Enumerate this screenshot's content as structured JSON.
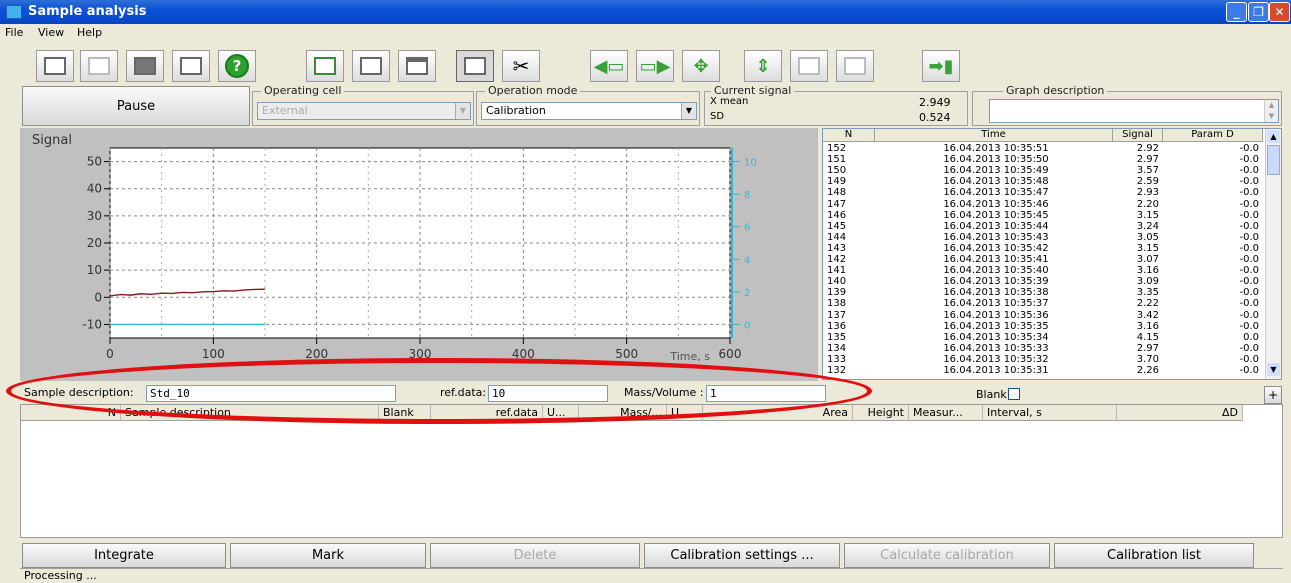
{
  "window": {
    "title": "Sample analysis",
    "minimize": "_",
    "maximize": "❐",
    "close": "✕"
  },
  "menu": [
    "File",
    "View",
    "Help"
  ],
  "toolbar_icons": [
    "new-file-icon",
    "open-folder-icon",
    "save-icon",
    "print-icon",
    "help-icon",
    "graph-icon",
    "table-icon",
    "window-icon",
    "layout-icon",
    "settings-icon",
    "shift-left-icon",
    "shift-right-icon",
    "move-icon",
    "fit-icon",
    "zoom-in-icon",
    "zoom-out-icon",
    "exit-icon"
  ],
  "controls": {
    "pause": "Pause",
    "operating_cell_label": "Operating cell",
    "operating_cell_value": "External",
    "operation_mode_label": "Operation mode",
    "operation_mode_value": "Calibration",
    "current_signal_label": "Current signal",
    "xmean_label": "X mean",
    "xmean_value": "2.949",
    "sd_label": "SD",
    "sd_value": "0.524",
    "graph_description_label": "Graph description",
    "graph_description_value": ""
  },
  "chart_data": {
    "type": "line",
    "ylabel": "Signal",
    "xlabel": "Time, s",
    "xlim": [
      0,
      600
    ],
    "ylim": [
      -15,
      55
    ],
    "x_ticks": [
      "0",
      "100",
      "200",
      "300",
      "400",
      "500",
      "600"
    ],
    "y_ticks": [
      "-10",
      "0",
      "10",
      "20",
      "30",
      "40",
      "50"
    ],
    "y2_ticks": [
      "0",
      "2",
      "4",
      "6",
      "8",
      "10"
    ],
    "series": [
      {
        "color": "#8b1a1a",
        "x": [
          0,
          10,
          20,
          30,
          40,
          50,
          60,
          70,
          80,
          90,
          100,
          110,
          120,
          130,
          140,
          150
        ],
        "y": [
          0.5,
          1.0,
          0.8,
          1.3,
          1.1,
          1.5,
          1.4,
          1.8,
          1.7,
          2.0,
          2.1,
          2.4,
          2.3,
          2.7,
          2.9,
          3.0
        ]
      },
      {
        "color": "#2fb9d8",
        "x": [
          0,
          150
        ],
        "y": [
          -10,
          -10
        ]
      }
    ]
  },
  "grid": {
    "headers": [
      "N",
      "Time",
      "Signal",
      "Param D"
    ],
    "rows": [
      [
        "152",
        "16.04.2013 10:35:51",
        "2.92",
        "-0.0"
      ],
      [
        "151",
        "16.04.2013 10:35:50",
        "2.97",
        "-0.0"
      ],
      [
        "150",
        "16.04.2013 10:35:49",
        "3.57",
        "-0.0"
      ],
      [
        "149",
        "16.04.2013 10:35:48",
        "2.59",
        "-0.0"
      ],
      [
        "148",
        "16.04.2013 10:35:47",
        "2.93",
        "-0.0"
      ],
      [
        "147",
        "16.04.2013 10:35:46",
        "2.20",
        "-0.0"
      ],
      [
        "146",
        "16.04.2013 10:35:45",
        "3.15",
        "-0.0"
      ],
      [
        "145",
        "16.04.2013 10:35:44",
        "3.24",
        "-0.0"
      ],
      [
        "144",
        "16.04.2013 10:35:43",
        "3.05",
        "-0.0"
      ],
      [
        "143",
        "16.04.2013 10:35:42",
        "3.15",
        "-0.0"
      ],
      [
        "142",
        "16.04.2013 10:35:41",
        "3.07",
        "-0.0"
      ],
      [
        "141",
        "16.04.2013 10:35:40",
        "3.16",
        "-0.0"
      ],
      [
        "140",
        "16.04.2013 10:35:39",
        "3.09",
        "-0.0"
      ],
      [
        "139",
        "16.04.2013 10:35:38",
        "3.35",
        "-0.0"
      ],
      [
        "138",
        "16.04.2013 10:35:37",
        "2.22",
        "-0.0"
      ],
      [
        "137",
        "16.04.2013 10:35:36",
        "3.42",
        "-0.0"
      ],
      [
        "136",
        "16.04.2013 10:35:35",
        "3.16",
        "-0.0"
      ],
      [
        "135",
        "16.04.2013 10:35:34",
        "4.15",
        "0.0"
      ],
      [
        "134",
        "16.04.2013 10:35:33",
        "2.97",
        "-0.0"
      ],
      [
        "133",
        "16.04.2013 10:35:32",
        "3.70",
        "-0.0"
      ],
      [
        "132",
        "16.04.2013 10:35:31",
        "2.26",
        "-0.0"
      ]
    ]
  },
  "sample": {
    "desc_label": "Sample description:",
    "desc_value": "Std_10",
    "ref_label": "ref.data:",
    "ref_value": "10",
    "mass_label": "Mass/Volume :",
    "mass_value": "1",
    "blank_label": "Blank",
    "add": "+"
  },
  "results_headers": [
    "N",
    "Sample description",
    "Blank",
    "ref.data",
    "U...",
    "Mass/...",
    "U...",
    "Area",
    "Height",
    "Measur...",
    "Interval, s",
    "ΔD"
  ],
  "bottom_buttons": [
    "Integrate",
    "Mark",
    "Delete",
    "Calibration settings ...",
    "Calculate calibration",
    "Calibration list"
  ],
  "status": "Processing ..."
}
